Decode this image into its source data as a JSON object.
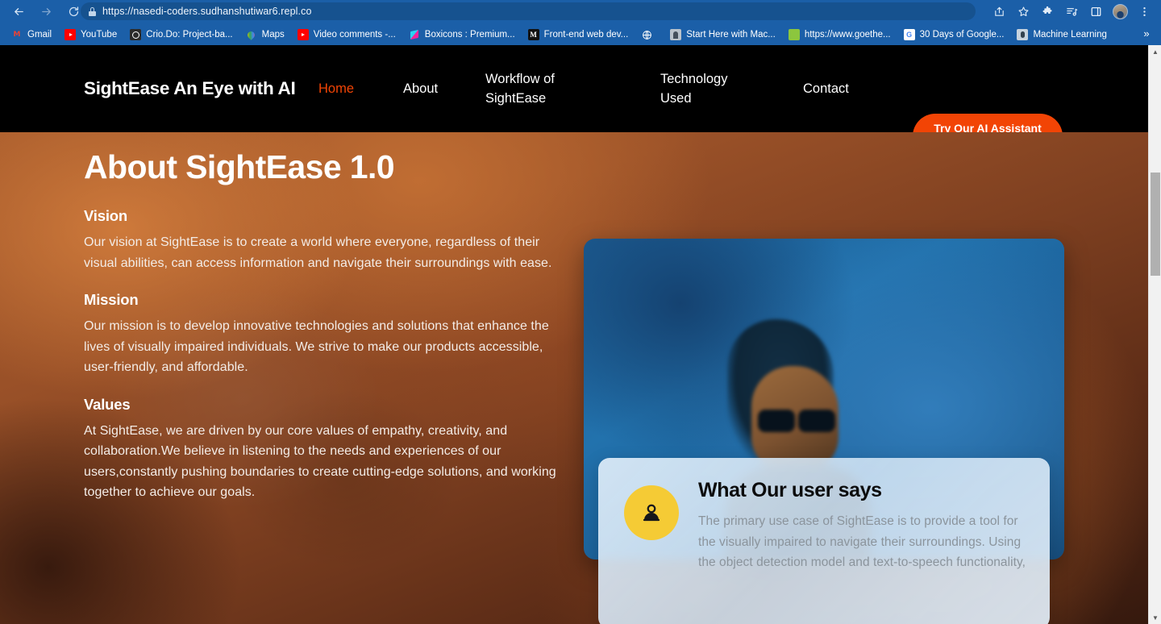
{
  "browser": {
    "url": "https://nasedi-coders.sudhanshutiwar6.repl.co",
    "back_icon": "back-arrow-icon",
    "forward_icon": "forward-arrow-icon",
    "reload_icon": "reload-icon",
    "lock_icon": "lock-icon",
    "toolbar_icons": [
      "share-icon",
      "bookmark-star-icon",
      "extensions-puzzle-icon",
      "reading-list-icon",
      "side-panel-icon",
      "profile-avatar",
      "chrome-menu-icon"
    ],
    "bookmarks": [
      {
        "label": "Gmail",
        "icon": "gmail-icon",
        "glyph": "M"
      },
      {
        "label": "YouTube",
        "icon": "youtube-icon",
        "glyph": ""
      },
      {
        "label": "Crio.Do: Project-ba...",
        "icon": "crio-icon",
        "glyph": ""
      },
      {
        "label": "Maps",
        "icon": "google-maps-icon",
        "glyph": ""
      },
      {
        "label": "Video comments -...",
        "icon": "youtube-icon",
        "glyph": ""
      },
      {
        "label": "Boxicons : Premium...",
        "icon": "boxicons-icon",
        "glyph": ""
      },
      {
        "label": "Front-end web dev...",
        "icon": "mdn-icon",
        "glyph": "M"
      },
      {
        "label": "",
        "icon": "globe-icon",
        "glyph": "⊕"
      },
      {
        "label": "Start Here with Mac...",
        "icon": "machine-learning-mastery-icon",
        "glyph": ""
      },
      {
        "label": "https://www.goethe...",
        "icon": "goethe-icon",
        "glyph": ""
      },
      {
        "label": "30 Days of Google...",
        "icon": "google-icon",
        "glyph": "G"
      },
      {
        "label": "Machine Learning",
        "icon": "machine-learning-icon",
        "glyph": ""
      }
    ],
    "overflow_label": "»"
  },
  "site": {
    "brand": "SightEase An Eye with AI",
    "nav": [
      {
        "label": "Home",
        "active": true
      },
      {
        "label": "About",
        "active": false
      },
      {
        "label": "Workflow of SightEase",
        "active": false
      },
      {
        "label": "Technology Used",
        "active": false
      },
      {
        "label": "Contact",
        "active": false
      }
    ],
    "cta_label": "Try Our AI Assistant Now",
    "accent_color": "#F24405",
    "header_bg": "#000000"
  },
  "about": {
    "title": "About SightEase 1.0",
    "sections": [
      {
        "heading": "Vision",
        "body": "Our vision at SightEase is to create a world where everyone, regardless of their visual abilities, can access information and navigate their surroundings with ease."
      },
      {
        "heading": "Mission",
        "body": "Our mission is to develop innovative technologies and solutions that enhance the lives of visually impaired individuals. We strive to make our products accessible, user-friendly, and affordable."
      },
      {
        "heading": "Values",
        "body": "At SightEase, we are driven by our core values of empathy, creativity, and collaboration.We believe in listening to the needs and experiences of our users,constantly pushing boundaries to create cutting-edge solutions, and working together to achieve our goals."
      }
    ]
  },
  "testimonial": {
    "avatar_icon": "user-person-icon",
    "avatar_color": "#F5CB35",
    "title": "What Our user says",
    "quote": "The primary use case of SightEase is to provide a tool for the visually impaired to navigate their surroundings. Using the object detection model and text-to-speech functionality,"
  },
  "media": {
    "alt": "blurred photo of a person wearing sunglasses against a blue background"
  },
  "scrollbar": {
    "up_arrow": "▲",
    "down_arrow": "▼"
  }
}
